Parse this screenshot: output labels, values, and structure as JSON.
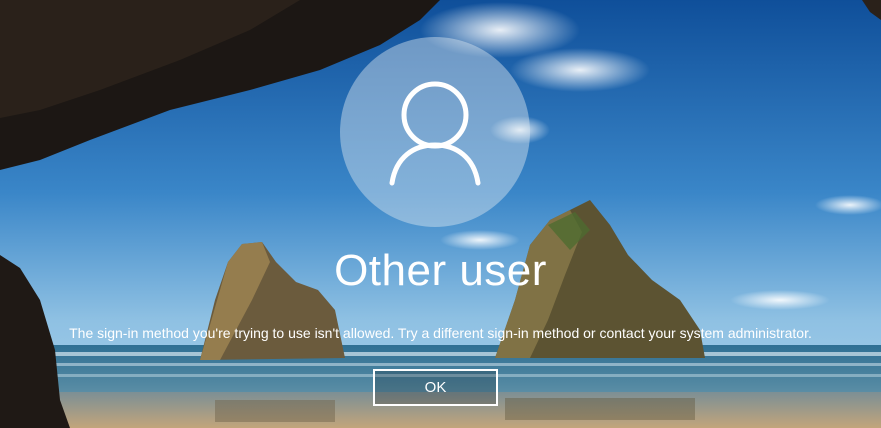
{
  "background": {
    "icon": "landscape-cave-beach-wallpaper"
  },
  "user": {
    "avatar_icon": "user-silhouette-icon",
    "name": "Other user"
  },
  "message": "The sign-in method you're trying to use isn't allowed. Try a different sign-in method or contact your system administrator.",
  "buttons": {
    "ok_label": "OK"
  }
}
